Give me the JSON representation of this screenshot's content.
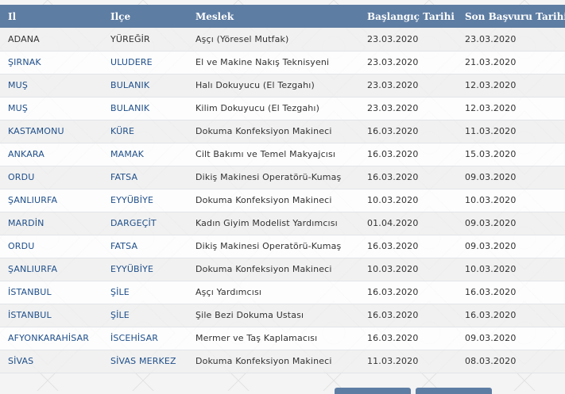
{
  "table": {
    "headers": {
      "il": "Il",
      "ilce": "Ilçe",
      "meslek": "Meslek",
      "baslangic": "Başlangıç Tarihi",
      "son_basvuru": "Son Başvuru Tarihi"
    },
    "rows": [
      {
        "il": "ADANA",
        "ilce": "YÜREĞİR",
        "meslek": "Aşçı (Yöresel Mutfak)",
        "baslangic": "23.03.2020",
        "son_basvuru": "23.03.2020"
      },
      {
        "il": "ŞIRNAK",
        "ilce": "ULUDERE",
        "meslek": "El ve Makine Nakış Teknisyeni",
        "baslangic": "23.03.2020",
        "son_basvuru": "21.03.2020"
      },
      {
        "il": "MUŞ",
        "ilce": "BULANIK",
        "meslek": "Halı Dokuyucu (El Tezgahı)",
        "baslangic": "23.03.2020",
        "son_basvuru": "12.03.2020"
      },
      {
        "il": "MUŞ",
        "ilce": "BULANIK",
        "meslek": "Kilim Dokuyucu (El Tezgahı)",
        "baslangic": "23.03.2020",
        "son_basvuru": "12.03.2020"
      },
      {
        "il": "KASTAMONU",
        "ilce": "KÜRE",
        "meslek": "Dokuma Konfeksiyon Makineci",
        "baslangic": "16.03.2020",
        "son_basvuru": "11.03.2020"
      },
      {
        "il": "ANKARA",
        "ilce": "MAMAK",
        "meslek": "Cilt Bakımı ve Temel Makyajcısı",
        "baslangic": "16.03.2020",
        "son_basvuru": "15.03.2020"
      },
      {
        "il": "ORDU",
        "ilce": "FATSA",
        "meslek": "Dikiş Makinesi Operatörü-Kumaş",
        "baslangic": "16.03.2020",
        "son_basvuru": "09.03.2020"
      },
      {
        "il": "ŞANLIURFA",
        "ilce": "EYYÜBİYE",
        "meslek": "Dokuma Konfeksiyon Makineci",
        "baslangic": "10.03.2020",
        "son_basvuru": "10.03.2020"
      },
      {
        "il": "MARDİN",
        "ilce": "DARGEÇİT",
        "meslek": "Kadın Giyim Modelist Yardımcısı",
        "baslangic": "01.04.2020",
        "son_basvuru": "09.03.2020"
      },
      {
        "il": "ORDU",
        "ilce": "FATSA",
        "meslek": "Dikiş Makinesi Operatörü-Kumaş",
        "baslangic": "16.03.2020",
        "son_basvuru": "09.03.2020"
      },
      {
        "il": "ŞANLIURFA",
        "ilce": "EYYÜBİYE",
        "meslek": "Dokuma Konfeksiyon Makineci",
        "baslangic": "10.03.2020",
        "son_basvuru": "10.03.2020"
      },
      {
        "il": "İSTANBUL",
        "ilce": "ŞİLE",
        "meslek": "Aşçı Yardımcısı",
        "baslangic": "16.03.2020",
        "son_basvuru": "16.03.2020"
      },
      {
        "il": "İSTANBUL",
        "ilce": "ŞİLE",
        "meslek": "Şile Bezi Dokuma Ustası",
        "baslangic": "16.03.2020",
        "son_basvuru": "16.03.2020"
      },
      {
        "il": "AFYONKARAHİSAR",
        "ilce": "İSCEHİSAR",
        "meslek": "Mermer ve Taş Kaplamacısı",
        "baslangic": "16.03.2020",
        "son_basvuru": "09.03.2020"
      },
      {
        "il": "SİVAS",
        "ilce": "SİVAS MERKEZ",
        "meslek": "Dokuma Konfeksiyon Makineci",
        "baslangic": "11.03.2020",
        "son_basvuru": "08.03.2020"
      }
    ]
  },
  "colors": {
    "header_bg": "#5e7da3",
    "link": "#1f4f8a",
    "text": "#333333"
  }
}
